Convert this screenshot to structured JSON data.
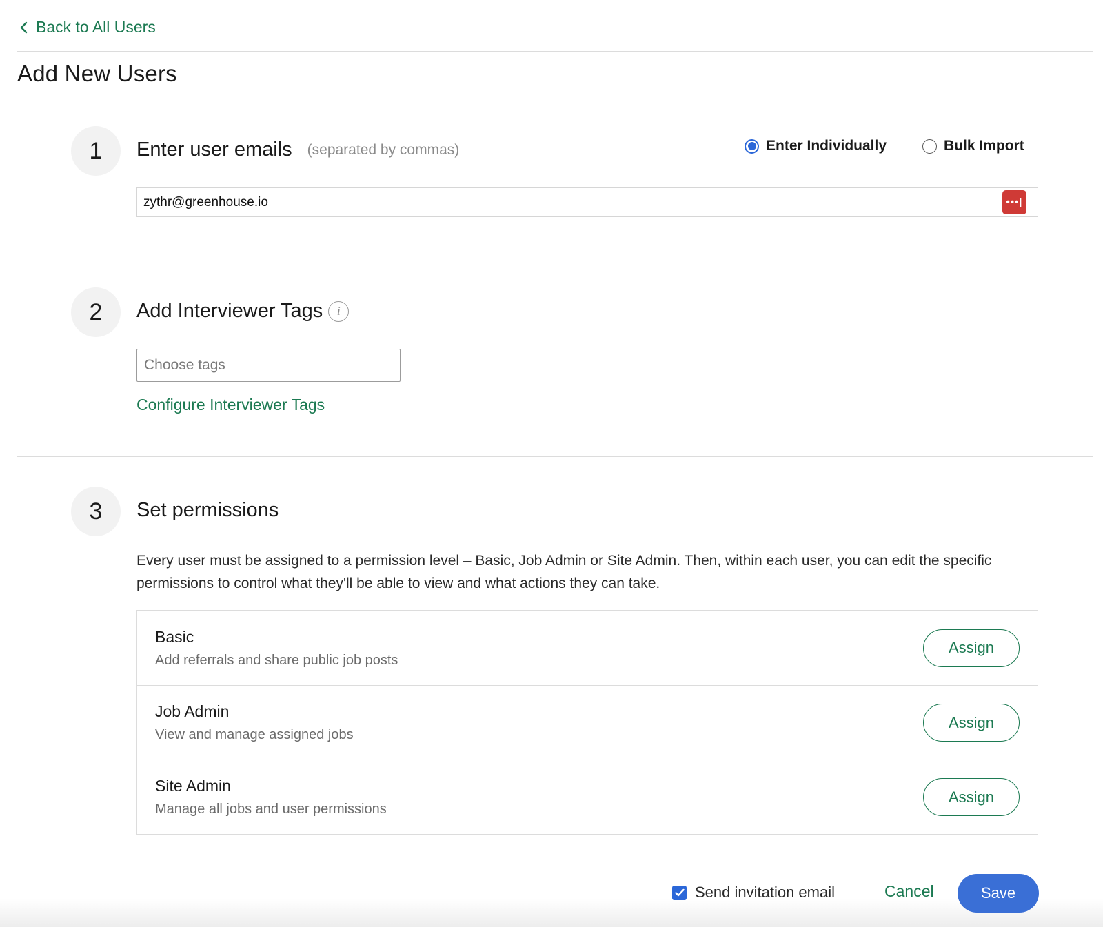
{
  "nav": {
    "back_label": "Back to All Users"
  },
  "page": {
    "title": "Add New Users"
  },
  "step1": {
    "number": "1",
    "title": "Enter user emails",
    "hint": "(separated by commas)",
    "mode_options": [
      {
        "label": "Enter Individually",
        "selected": true
      },
      {
        "label": "Bulk Import",
        "selected": false
      }
    ],
    "email_value": "zythr@greenhouse.io",
    "password_manager_icon": "password-manager-icon"
  },
  "step2": {
    "number": "2",
    "title": "Add Interviewer Tags",
    "info_glyph": "i",
    "tags_placeholder": "Choose tags",
    "configure_label": "Configure Interviewer Tags"
  },
  "step3": {
    "number": "3",
    "title": "Set permissions",
    "description": "Every user must be assigned to a permission level – Basic, Job Admin or Site Admin. Then, within each user, you can edit the specific permissions to control what they'll be able to view and what actions they can take.",
    "levels": [
      {
        "name": "Basic",
        "description": "Add referrals and share public job posts",
        "button": "Assign"
      },
      {
        "name": "Job Admin",
        "description": "View and manage assigned jobs",
        "button": "Assign"
      },
      {
        "name": "Site Admin",
        "description": "Manage all jobs and user permissions",
        "button": "Assign"
      }
    ]
  },
  "footer": {
    "send_invitation_label": "Send invitation email",
    "send_invitation_checked": true,
    "cancel_label": "Cancel",
    "save_label": "Save"
  },
  "colors": {
    "link_green": "#1c7a52",
    "primary_blue": "#3a6fd6",
    "radio_blue": "#2b67d8",
    "password_icon_red": "#cf3a36"
  }
}
